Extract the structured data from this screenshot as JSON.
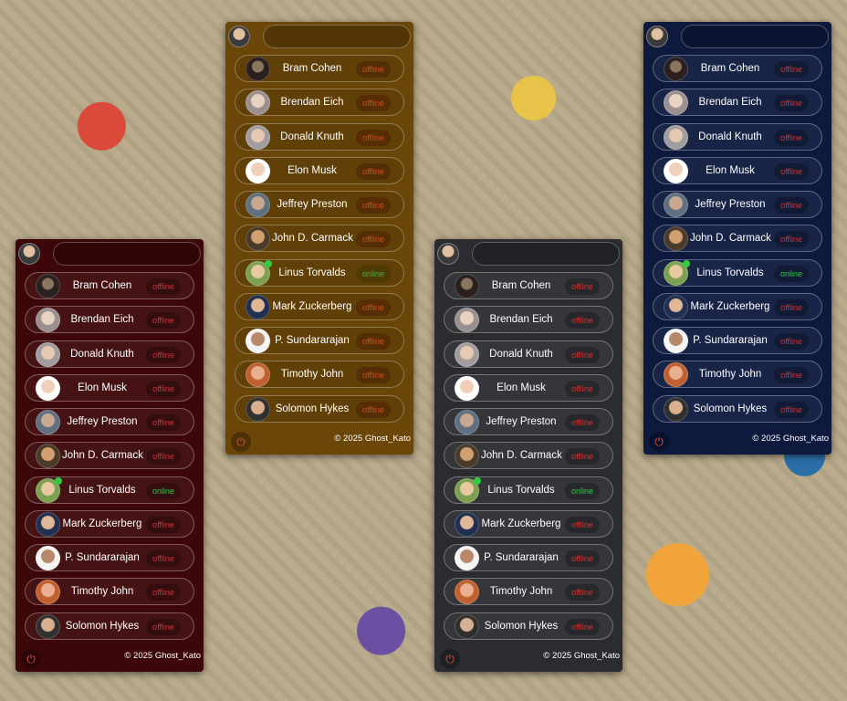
{
  "copyright": "© 2025 Ghost_Kato",
  "search": {
    "placeholder": ""
  },
  "contacts": [
    {
      "name": "Bram Cohen",
      "status": "offline",
      "avatar_icon": "bram-cohen-avatar"
    },
    {
      "name": "Brendan Eich",
      "status": "offline",
      "avatar_icon": "brendan-eich-avatar"
    },
    {
      "name": "Donald Knuth",
      "status": "offline",
      "avatar_icon": "donald-knuth-avatar"
    },
    {
      "name": "Elon Musk",
      "status": "offline",
      "avatar_icon": "elon-musk-avatar"
    },
    {
      "name": "Jeffrey Preston",
      "status": "offline",
      "avatar_icon": "jeffrey-preston-avatar"
    },
    {
      "name": "John D. Carmack",
      "status": "offline",
      "avatar_icon": "john-carmack-avatar"
    },
    {
      "name": "Linus Torvalds",
      "status": "online",
      "avatar_icon": "linus-torvalds-avatar"
    },
    {
      "name": "Mark Zuckerberg",
      "status": "offline",
      "avatar_icon": "mark-zuckerberg-avatar"
    },
    {
      "name": "P. Sundararajan",
      "status": "offline",
      "avatar_icon": "p-sundararajan-avatar"
    },
    {
      "name": "Timothy John",
      "status": "offline",
      "avatar_icon": "timothy-john-avatar"
    },
    {
      "name": "Solomon Hykes",
      "status": "offline",
      "avatar_icon": "solomon-hykes-avatar"
    }
  ],
  "panels": [
    {
      "theme": "red",
      "background": "#3d0709"
    },
    {
      "theme": "brown",
      "background": "#6a4609"
    },
    {
      "theme": "gray",
      "background": "#2a2c30"
    },
    {
      "theme": "navy",
      "background": "#0d1a3e"
    }
  ],
  "colors": {
    "offline": "#d23030",
    "online": "#2ecc40",
    "online_dot": "#2ecc40",
    "logout_icon": "#e0524a"
  },
  "icons": {
    "user_avatar": "user-avatar-icon",
    "logout": "logout-icon",
    "online_indicator": "online-dot-icon"
  }
}
